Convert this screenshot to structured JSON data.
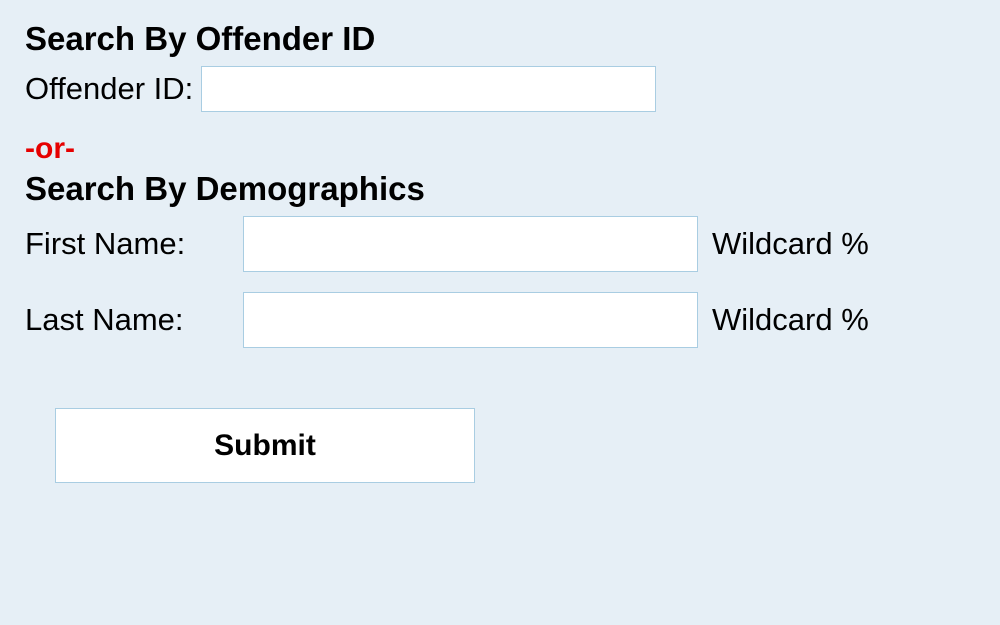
{
  "search_by_id": {
    "heading": "Search By Offender ID",
    "offender_id_label": "Offender ID:",
    "offender_id_value": ""
  },
  "separator": "-or-",
  "search_by_demographics": {
    "heading": "Search By Demographics",
    "first_name_label": "First Name:",
    "first_name_value": "",
    "first_name_hint": "Wildcard %",
    "last_name_label": "Last Name:",
    "last_name_value": "",
    "last_name_hint": "Wildcard %"
  },
  "submit_label": "Submit"
}
